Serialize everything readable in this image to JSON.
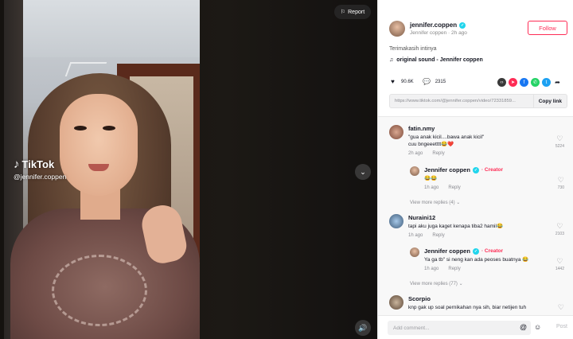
{
  "video": {
    "watermark_brand": "TikTok",
    "watermark_handle": "@jennifer.coppen",
    "report_label": "Report"
  },
  "author": {
    "name": "jennifer.coppen",
    "subtitle": "Jennifer coppen · 2h ago",
    "follow_label": "Follow"
  },
  "post": {
    "caption": "Terimakasih intinya ",
    "sound": "original sound - Jennifer coppen"
  },
  "stats": {
    "likes": "90.6K",
    "comments": "2315"
  },
  "share": {
    "url": "https://www.tiktok.com/@jennifer.coppen/video/72331859...",
    "copy_label": "Copy link",
    "colors": [
      "#3a3a3a",
      "#fe2c55",
      "#1877f2",
      "#25d366",
      "#1da1f2"
    ]
  },
  "comments": [
    {
      "user": "fatin.nmy",
      "text1": "\"gua anak kicil....bawa anak kicil\"",
      "text2": "cuu bngeeetttt😂❤️",
      "time": "2h ago",
      "reply": "Reply",
      "likes": "5224"
    },
    {
      "user": "Jennifer coppen",
      "creator": "· Creator",
      "text1": "😂😂",
      "time": "1h ago",
      "reply": "Reply",
      "likes": "730"
    },
    {
      "view_more": "View more replies (4) ⌄"
    },
    {
      "user": "Nuraini12",
      "text1": "tapi aku juga kaget kenapa tiba2 hamil😂",
      "time": "1h ago",
      "reply": "Reply",
      "likes": "2103"
    },
    {
      "user": "Jennifer coppen",
      "creator": "· Creator",
      "text1": "Ya ga tb\" si neng kan ada peoses buatnya 😂",
      "time": "1h ago",
      "reply": "Reply",
      "likes": "1442"
    },
    {
      "view_more": "View more replies (77) ⌄"
    },
    {
      "user": "Scorpio",
      "text1": "knp gak up soal pernikahan nya sih, biar netijen tuh",
      "likes": ""
    }
  ],
  "add_comment": {
    "placeholder": "Add comment...",
    "post_label": "Post"
  }
}
